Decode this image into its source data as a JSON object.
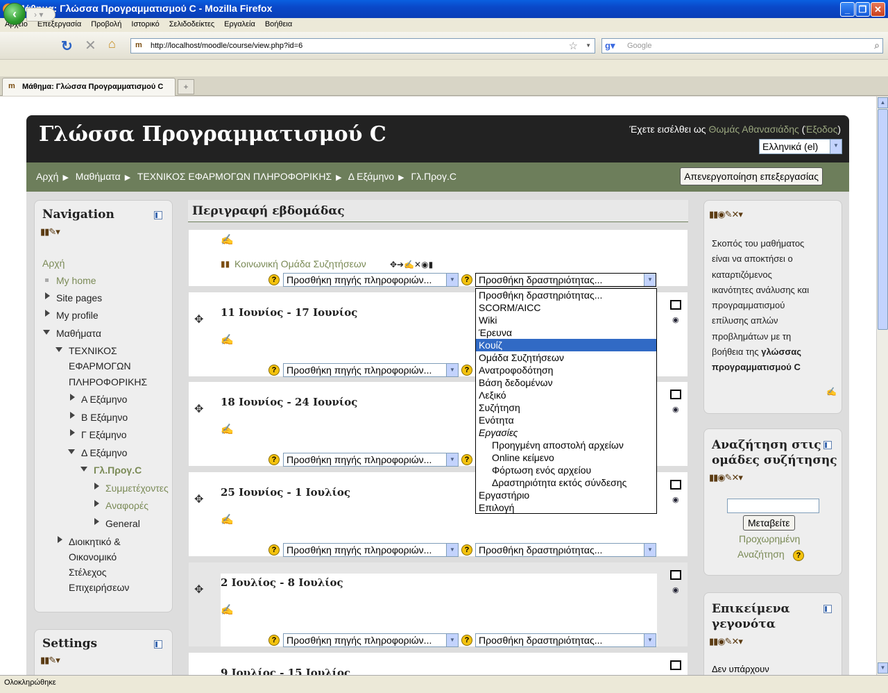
{
  "window": {
    "title": "Μάθημα: Γλώσσα Προγραμματισμού C - Mozilla Firefox",
    "min": "_",
    "max": "❐",
    "close": "✕"
  },
  "menu": [
    "Αρχείο",
    "Επεξεργασία",
    "Προβολή",
    "Ιστορικό",
    "Σελιδοδείκτες",
    "Εργαλεία",
    "Βοήθεια"
  ],
  "toolbar": {
    "url": "http://localhost/moodle/course/view.php?id=6",
    "search_placeholder": "Google"
  },
  "tab": {
    "label": "Μάθημα: Γλώσσα Προγραμματισμού C",
    "new": "+"
  },
  "status": "Ολοκληρώθηκε",
  "course": {
    "title": "Γλώσσα Προγραμματισμού C",
    "login_prefix": "Έχετε εισέλθει ως ",
    "user": "Θωμάς Αθανασιάδης",
    "logout_open": " (",
    "logout": "Έξοδος",
    "logout_close": ")",
    "language": "Ελληνικά (el)",
    "breadcrumbs": [
      "Αρχή",
      "Μαθήματα",
      "ΤΕΧΝΙΚΟΣ ΕΦΑΡΜΟΓΩΝ ΠΛΗΡΟΦΟΡΙΚΗΣ",
      "Δ Εξάμηνο",
      "Γλ.Προγ.C"
    ],
    "edit_button": "Απενεργοποίηση επεξεργασίας"
  },
  "navigation": {
    "title": "Navigation",
    "items": {
      "home": "Αρχή",
      "myhome": "My home",
      "sitepages": "Site pages",
      "myprofile": "My profile",
      "courses": "Μαθήματα",
      "dept1": "ΤΕΧΝΙΚΟΣ",
      "dept2": "ΕΦΑΡΜΟΓΩΝ",
      "dept3": "ΠΛΗΡΟΦΟΡΙΚΗΣ",
      "semA": "Α Εξάμηνο",
      "semB": "Β Εξάμηνο",
      "semC": "Γ Εξάμηνο",
      "semD": "Δ Εξάμηνο",
      "course": "Γλ.Προγ.C",
      "participants": "Συμμετέχοντες",
      "reports": "Αναφορές",
      "general": "General",
      "admin1": "Διοικητικό &",
      "admin2": "Οικονομικό",
      "admin3": "Στέλεχος",
      "admin4": "Επιχειρήσεων"
    }
  },
  "settings": {
    "title": "Settings"
  },
  "main": {
    "title": "Περιγραφή εβδομάδας",
    "forum": "Κοινωνική Ομάδα Συζητήσεων",
    "add_resource": "Προσθήκη πηγής πληροφοριών...",
    "add_activity": "Προσθήκη δραστηριότητας...",
    "weeks": [
      "11 Ιουνίος - 17 Ιουνίος",
      "18 Ιουνίος - 24 Ιουνίος",
      "25 Ιουνίος - 1 Ιουλίος",
      "2 Ιουλίος - 8 Ιουλίος",
      "9 Ιουλίος - 15 Ιουλίος"
    ]
  },
  "dropdown": [
    {
      "label": "Προσθήκη δραστηριότητας...",
      "kind": "opt"
    },
    {
      "label": "SCORM/AICC",
      "kind": "opt"
    },
    {
      "label": "Wiki",
      "kind": "opt"
    },
    {
      "label": "Έρευνα",
      "kind": "opt"
    },
    {
      "label": "Κουίζ",
      "kind": "sel"
    },
    {
      "label": "Ομάδα Συζητήσεων",
      "kind": "opt"
    },
    {
      "label": "Ανατροφοδότηση",
      "kind": "opt"
    },
    {
      "label": "Βάση δεδομένων",
      "kind": "opt"
    },
    {
      "label": "Λεξικό",
      "kind": "opt"
    },
    {
      "label": "Συζήτηση",
      "kind": "opt"
    },
    {
      "label": "Ενότητα",
      "kind": "opt"
    },
    {
      "label": "Εργασίες",
      "kind": "grp"
    },
    {
      "label": "Προηγμένη αποστολή αρχείων",
      "kind": "sub"
    },
    {
      "label": "Online κείμενο",
      "kind": "sub"
    },
    {
      "label": "Φόρτωση ενός αρχείου",
      "kind": "sub"
    },
    {
      "label": "Δραστηριότητα εκτός σύνδεσης",
      "kind": "sub"
    },
    {
      "label": "Εργαστήριο",
      "kind": "opt"
    },
    {
      "label": "Επιλογή",
      "kind": "opt"
    }
  ],
  "summary": {
    "l1": "Σκοπός του μαθήματος",
    "l2": "είναι να αποκτήσει ο",
    "l3": "καταρτιζόμενος",
    "l4": "ικανότητες ανάλυσης και",
    "l5": "προγραμματισμού",
    "l6": "επίλυσης απλών",
    "l7": "προβλημάτων με τη",
    "l8": "βοήθεια της ",
    "l8b": "γλώσσας",
    "l9": "προγραμματισμού C"
  },
  "forumsearch": {
    "title1": "Αναζήτηση στις",
    "title2": "ομάδες συζήτησης",
    "button": "Μεταβείτε",
    "advanced1": "Προχωρημένη",
    "advanced2": "Αναζήτηση"
  },
  "events": {
    "title1": "Επικείμενα",
    "title2": "γεγονότα",
    "text": "Δεν υπάρχουν"
  },
  "icon_names": [
    "back-icon",
    "forward-icon",
    "reload-icon",
    "stop-icon",
    "home-icon",
    "star-icon",
    "search-icon",
    "help-icon",
    "move-icon",
    "edit-icon",
    "eye-icon"
  ]
}
